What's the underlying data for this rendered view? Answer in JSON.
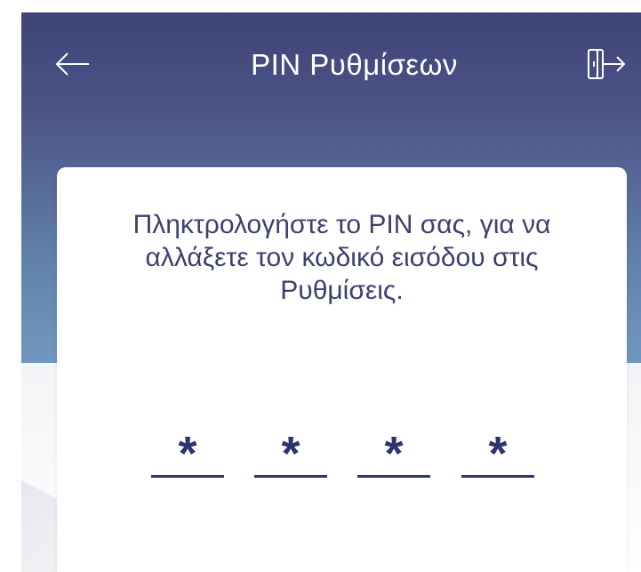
{
  "header": {
    "title": "PIN Ρυθμίσεων",
    "back_icon": "arrow-left-icon",
    "exit_icon": "exit-door-icon"
  },
  "card": {
    "instruction": "Πληκτρολογήστε το PIN σας, για να αλλάξετε τον κωδικό εισόδου στις Ρυθμίσεις.",
    "pin_digits": [
      "*",
      "*",
      "*",
      "*"
    ]
  },
  "colors": {
    "header_top": "#3f4377",
    "header_bottom": "#7097c0",
    "text_primary": "#3d416b",
    "pin_color": "#2c3470",
    "card_background": "#ffffff"
  }
}
